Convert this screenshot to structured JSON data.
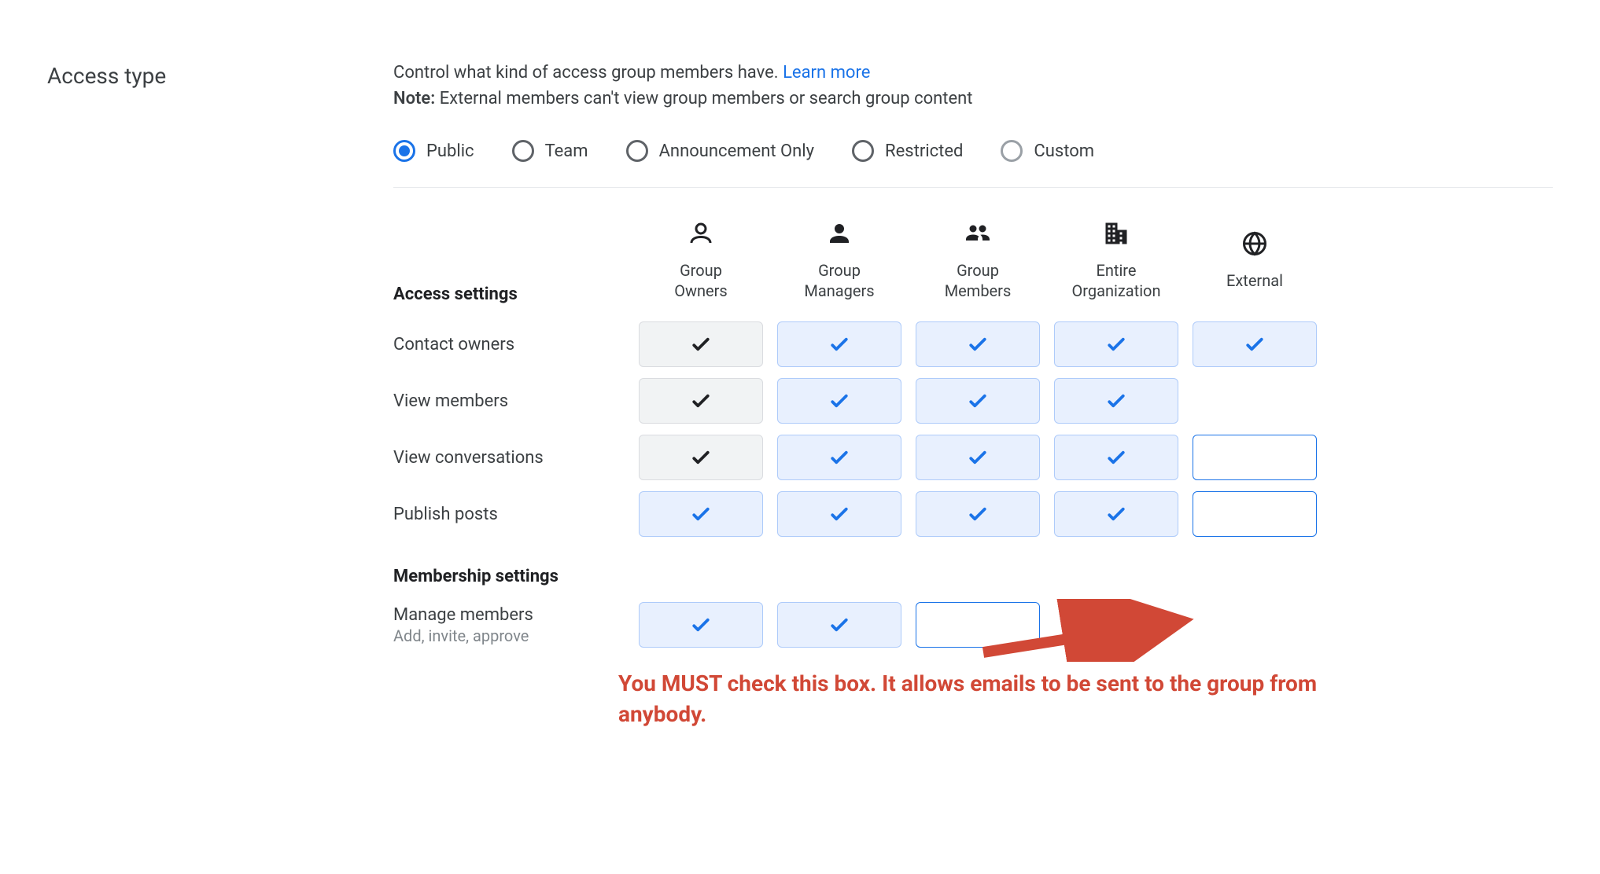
{
  "section_title": "Access type",
  "description_prefix": "Control what kind of access group members have. ",
  "learn_more": "Learn more",
  "note_bold": "Note:",
  "note_text": " External members can't view group members or search group content",
  "radios": [
    {
      "label": "Public",
      "selected": true,
      "dimmed": false
    },
    {
      "label": "Team",
      "selected": false,
      "dimmed": false
    },
    {
      "label": "Announcement Only",
      "selected": false,
      "dimmed": false
    },
    {
      "label": "Restricted",
      "selected": false,
      "dimmed": false
    },
    {
      "label": "Custom",
      "selected": false,
      "dimmed": true
    }
  ],
  "columns": [
    {
      "label": "Group Owners",
      "icon": "person-outline"
    },
    {
      "label": "Group Managers",
      "icon": "person-fill"
    },
    {
      "label": "Group Members",
      "icon": "people-fill"
    },
    {
      "label": "Entire Organization",
      "icon": "domain"
    },
    {
      "label": "External",
      "icon": "globe"
    }
  ],
  "access_heading": "Access settings",
  "membership_heading": "Membership settings",
  "access_rows": [
    {
      "label": "Contact owners",
      "cells": [
        "gray-checked",
        "blue-checked",
        "blue-checked",
        "blue-checked",
        "blue-checked"
      ]
    },
    {
      "label": "View members",
      "cells": [
        "gray-checked",
        "blue-checked",
        "blue-checked",
        "blue-checked",
        "none"
      ]
    },
    {
      "label": "View conversations",
      "cells": [
        "gray-checked",
        "blue-checked",
        "blue-checked",
        "blue-checked",
        "empty"
      ]
    },
    {
      "label": "Publish posts",
      "cells": [
        "blue-checked",
        "blue-checked",
        "blue-checked",
        "blue-checked",
        "empty"
      ]
    }
  ],
  "membership_rows": [
    {
      "label": "Manage members",
      "sub": "Add, invite, approve",
      "cells": [
        "blue-checked",
        "blue-checked",
        "empty",
        "none",
        "none"
      ]
    }
  ],
  "annotation": "You MUST check this box. It allows emails to be sent to the group from anybody."
}
